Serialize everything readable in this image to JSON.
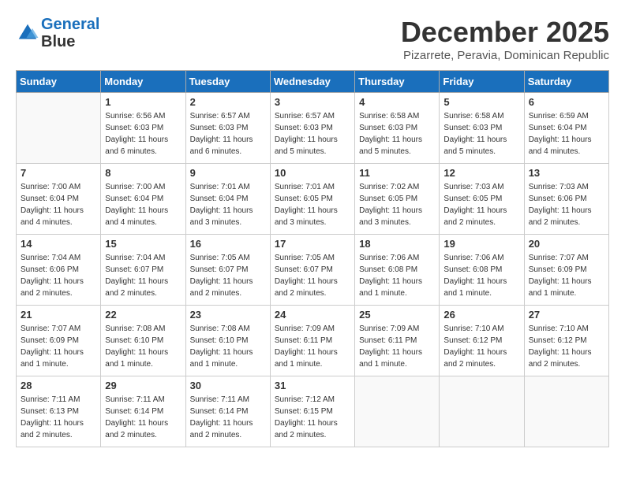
{
  "header": {
    "logo_line1": "General",
    "logo_line2": "Blue",
    "month": "December 2025",
    "location": "Pizarrete, Peravia, Dominican Republic"
  },
  "weekdays": [
    "Sunday",
    "Monday",
    "Tuesday",
    "Wednesday",
    "Thursday",
    "Friday",
    "Saturday"
  ],
  "weeks": [
    [
      {
        "day": "",
        "empty": true
      },
      {
        "day": "1",
        "sunrise": "6:56 AM",
        "sunset": "6:03 PM",
        "daylight": "11 hours and 6 minutes."
      },
      {
        "day": "2",
        "sunrise": "6:57 AM",
        "sunset": "6:03 PM",
        "daylight": "11 hours and 6 minutes."
      },
      {
        "day": "3",
        "sunrise": "6:57 AM",
        "sunset": "6:03 PM",
        "daylight": "11 hours and 5 minutes."
      },
      {
        "day": "4",
        "sunrise": "6:58 AM",
        "sunset": "6:03 PM",
        "daylight": "11 hours and 5 minutes."
      },
      {
        "day": "5",
        "sunrise": "6:58 AM",
        "sunset": "6:03 PM",
        "daylight": "11 hours and 5 minutes."
      },
      {
        "day": "6",
        "sunrise": "6:59 AM",
        "sunset": "6:04 PM",
        "daylight": "11 hours and 4 minutes."
      }
    ],
    [
      {
        "day": "7",
        "sunrise": "7:00 AM",
        "sunset": "6:04 PM",
        "daylight": "11 hours and 4 minutes."
      },
      {
        "day": "8",
        "sunrise": "7:00 AM",
        "sunset": "6:04 PM",
        "daylight": "11 hours and 4 minutes."
      },
      {
        "day": "9",
        "sunrise": "7:01 AM",
        "sunset": "6:04 PM",
        "daylight": "11 hours and 3 minutes."
      },
      {
        "day": "10",
        "sunrise": "7:01 AM",
        "sunset": "6:05 PM",
        "daylight": "11 hours and 3 minutes."
      },
      {
        "day": "11",
        "sunrise": "7:02 AM",
        "sunset": "6:05 PM",
        "daylight": "11 hours and 3 minutes."
      },
      {
        "day": "12",
        "sunrise": "7:03 AM",
        "sunset": "6:05 PM",
        "daylight": "11 hours and 2 minutes."
      },
      {
        "day": "13",
        "sunrise": "7:03 AM",
        "sunset": "6:06 PM",
        "daylight": "11 hours and 2 minutes."
      }
    ],
    [
      {
        "day": "14",
        "sunrise": "7:04 AM",
        "sunset": "6:06 PM",
        "daylight": "11 hours and 2 minutes."
      },
      {
        "day": "15",
        "sunrise": "7:04 AM",
        "sunset": "6:07 PM",
        "daylight": "11 hours and 2 minutes."
      },
      {
        "day": "16",
        "sunrise": "7:05 AM",
        "sunset": "6:07 PM",
        "daylight": "11 hours and 2 minutes."
      },
      {
        "day": "17",
        "sunrise": "7:05 AM",
        "sunset": "6:07 PM",
        "daylight": "11 hours and 2 minutes."
      },
      {
        "day": "18",
        "sunrise": "7:06 AM",
        "sunset": "6:08 PM",
        "daylight": "11 hours and 1 minute."
      },
      {
        "day": "19",
        "sunrise": "7:06 AM",
        "sunset": "6:08 PM",
        "daylight": "11 hours and 1 minute."
      },
      {
        "day": "20",
        "sunrise": "7:07 AM",
        "sunset": "6:09 PM",
        "daylight": "11 hours and 1 minute."
      }
    ],
    [
      {
        "day": "21",
        "sunrise": "7:07 AM",
        "sunset": "6:09 PM",
        "daylight": "11 hours and 1 minute."
      },
      {
        "day": "22",
        "sunrise": "7:08 AM",
        "sunset": "6:10 PM",
        "daylight": "11 hours and 1 minute."
      },
      {
        "day": "23",
        "sunrise": "7:08 AM",
        "sunset": "6:10 PM",
        "daylight": "11 hours and 1 minute."
      },
      {
        "day": "24",
        "sunrise": "7:09 AM",
        "sunset": "6:11 PM",
        "daylight": "11 hours and 1 minute."
      },
      {
        "day": "25",
        "sunrise": "7:09 AM",
        "sunset": "6:11 PM",
        "daylight": "11 hours and 1 minute."
      },
      {
        "day": "26",
        "sunrise": "7:10 AM",
        "sunset": "6:12 PM",
        "daylight": "11 hours and 2 minutes."
      },
      {
        "day": "27",
        "sunrise": "7:10 AM",
        "sunset": "6:12 PM",
        "daylight": "11 hours and 2 minutes."
      }
    ],
    [
      {
        "day": "28",
        "sunrise": "7:11 AM",
        "sunset": "6:13 PM",
        "daylight": "11 hours and 2 minutes."
      },
      {
        "day": "29",
        "sunrise": "7:11 AM",
        "sunset": "6:14 PM",
        "daylight": "11 hours and 2 minutes."
      },
      {
        "day": "30",
        "sunrise": "7:11 AM",
        "sunset": "6:14 PM",
        "daylight": "11 hours and 2 minutes."
      },
      {
        "day": "31",
        "sunrise": "7:12 AM",
        "sunset": "6:15 PM",
        "daylight": "11 hours and 2 minutes."
      },
      {
        "day": "",
        "empty": true
      },
      {
        "day": "",
        "empty": true
      },
      {
        "day": "",
        "empty": true
      }
    ]
  ]
}
